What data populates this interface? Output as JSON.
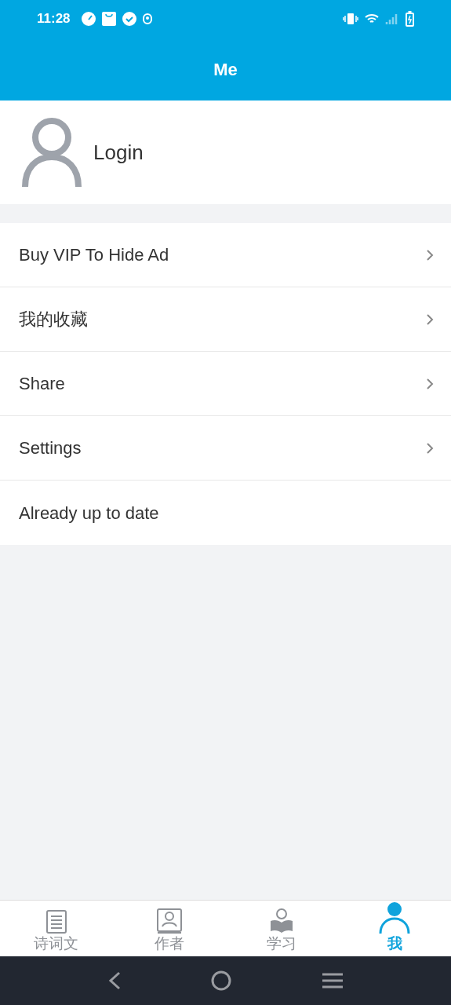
{
  "status_bar": {
    "time": "11:28"
  },
  "header": {
    "title": "Me"
  },
  "profile": {
    "label": "Login"
  },
  "menu": [
    {
      "label": "Buy VIP To Hide Ad",
      "chevron": true
    },
    {
      "label": "我的收藏",
      "chevron": true
    },
    {
      "label": "Share",
      "chevron": true
    },
    {
      "label": "Settings",
      "chevron": true
    },
    {
      "label": "Already up to date",
      "chevron": false
    }
  ],
  "tabs": [
    {
      "label": "诗词文",
      "kind": "document",
      "selected": false
    },
    {
      "label": "作者",
      "kind": "author",
      "selected": false
    },
    {
      "label": "学习",
      "kind": "reader",
      "selected": false
    },
    {
      "label": "我",
      "kind": "person",
      "selected": true
    }
  ]
}
